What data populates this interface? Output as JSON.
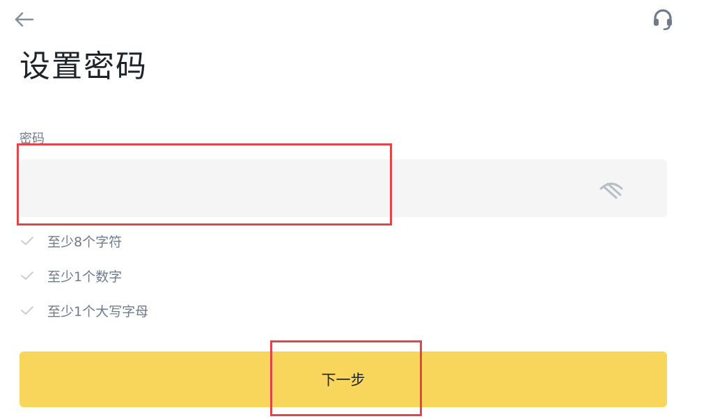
{
  "page": {
    "title": "设置密码"
  },
  "icons": {
    "back": "arrow-left-icon",
    "support": "headset-icon",
    "visibility": "eye-off-icon",
    "requirement": "check-icon"
  },
  "password": {
    "label": "密码",
    "value": "",
    "placeholder": ""
  },
  "requirements": [
    {
      "text": "至少8个字符"
    },
    {
      "text": "至少1个数字"
    },
    {
      "text": "至少1个大写字母"
    }
  ],
  "next_button": {
    "label": "下一步"
  },
  "colors": {
    "primary_button": "#f8d65b",
    "field_background": "#f5f5f5",
    "muted_text": "#707a8a",
    "highlight_box": "#e0454a"
  }
}
